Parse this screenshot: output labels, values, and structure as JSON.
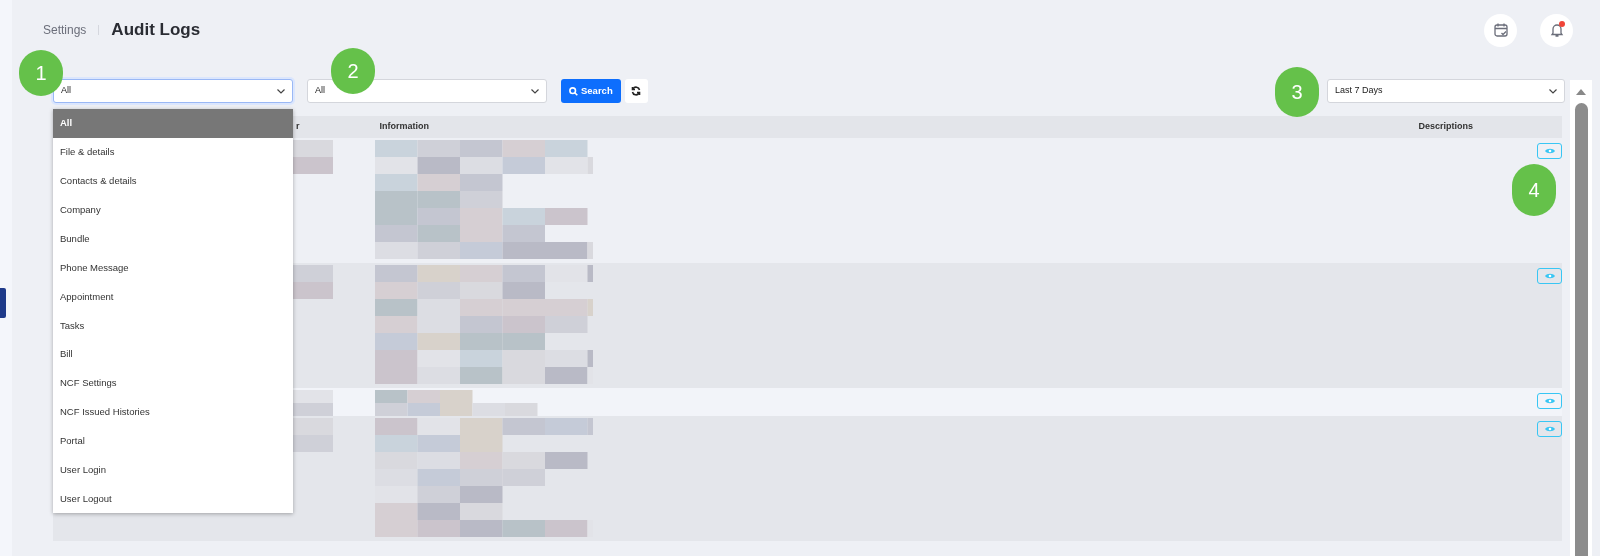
{
  "breadcrumb": {
    "parent": "Settings",
    "title": "Audit Logs"
  },
  "header_icons": {
    "notification_dot": true
  },
  "filters": {
    "module_select": {
      "value": "All",
      "expanded": true,
      "options": [
        {
          "label": "All",
          "selected": true
        },
        {
          "label": "File & details",
          "selected": false
        },
        {
          "label": "Contacts & details",
          "selected": false
        },
        {
          "label": "Company",
          "selected": false
        },
        {
          "label": "Bundle",
          "selected": false
        },
        {
          "label": "Phone Message",
          "selected": false
        },
        {
          "label": "Appointment",
          "selected": false
        },
        {
          "label": "Tasks",
          "selected": false
        },
        {
          "label": "Bill",
          "selected": false
        },
        {
          "label": "NCF Settings",
          "selected": false
        },
        {
          "label": "NCF Issued Histories",
          "selected": false
        },
        {
          "label": "Portal",
          "selected": false
        },
        {
          "label": "User Login",
          "selected": false
        },
        {
          "label": "User Logout",
          "selected": false
        }
      ]
    },
    "second_select": {
      "value": "All"
    },
    "search_button": "Search",
    "date_range": {
      "value": "Last 7 Days"
    }
  },
  "table": {
    "columns": [
      "r",
      "Information",
      "Descriptions"
    ],
    "rows": [
      {
        "kind": "tall"
      },
      {
        "kind": "tall"
      },
      {
        "kind": "short"
      },
      {
        "kind": "tall"
      }
    ]
  },
  "annotations": [
    {
      "label": "1"
    },
    {
      "label": "2"
    },
    {
      "label": "3"
    },
    {
      "label": "4"
    }
  ]
}
